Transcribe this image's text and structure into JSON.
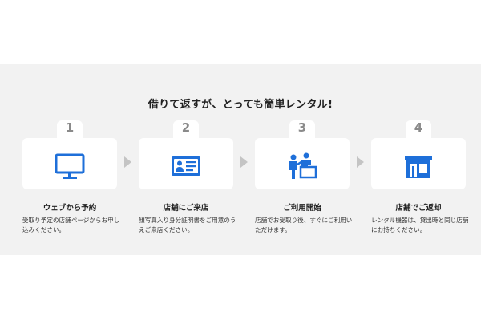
{
  "heading": "借りて返すが、とっても簡単レンタル!",
  "steps": [
    {
      "num": "1",
      "icon": "monitor-icon",
      "title": "ウェブから予約",
      "desc": "受取り予定の店舗ページからお申し込みください。"
    },
    {
      "num": "2",
      "icon": "id-card-icon",
      "title": "店舗にご来店",
      "desc": "顔写真入り身分証明書をご用意のうえご来店ください。"
    },
    {
      "num": "3",
      "icon": "counter-staff-icon",
      "title": "ご利用開始",
      "desc": "店舗でお受取り後、すぐにご利用いただけます。"
    },
    {
      "num": "4",
      "icon": "store-icon",
      "title": "店舗でご返却",
      "desc": "レンタル機器は、貸出時と同じ店舗にお持ちください。"
    }
  ],
  "colors": {
    "accent": "#1e6fd9",
    "number": "#8a8a8a",
    "band": "#f2f2f2",
    "arrow": "#c4c4c4"
  }
}
